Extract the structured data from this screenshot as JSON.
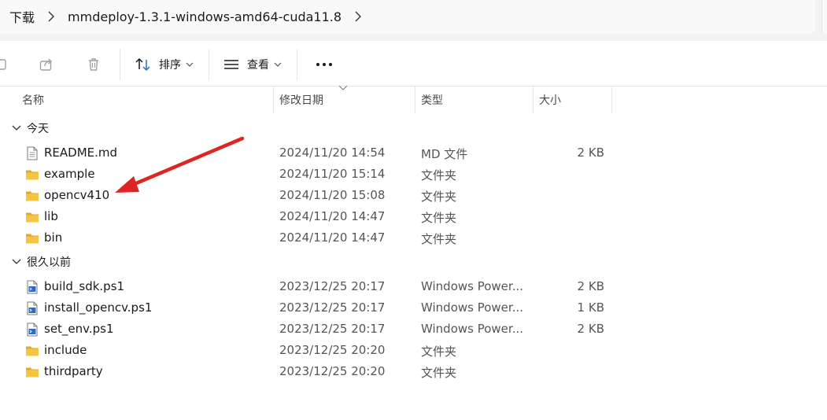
{
  "breadcrumb": [
    "下载",
    "mmdeploy-1.3.1-windows-amd64-cuda11.8"
  ],
  "toolbar": {
    "sort_label": "排序",
    "view_label": "查看"
  },
  "columns": {
    "name": "名称",
    "date": "修改日期",
    "type": "类型",
    "size": "大小"
  },
  "groups": [
    {
      "label": "今天",
      "items": [
        {
          "name": "README.md",
          "date": "2024/11/20 14:54",
          "type": "MD 文件",
          "size": "2 KB",
          "icon": "document-icon"
        },
        {
          "name": "example",
          "date": "2024/11/20 15:14",
          "type": "文件夹",
          "size": "",
          "icon": "folder-icon"
        },
        {
          "name": "opencv410",
          "date": "2024/11/20 15:08",
          "type": "文件夹",
          "size": "",
          "icon": "folder-icon"
        },
        {
          "name": "lib",
          "date": "2024/11/20 14:47",
          "type": "文件夹",
          "size": "",
          "icon": "folder-icon"
        },
        {
          "name": "bin",
          "date": "2024/11/20 14:47",
          "type": "文件夹",
          "size": "",
          "icon": "folder-icon"
        }
      ]
    },
    {
      "label": "很久以前",
      "items": [
        {
          "name": "build_sdk.ps1",
          "date": "2023/12/25 20:17",
          "type": "Windows Power...",
          "size": "2 KB",
          "icon": "powershell-script-icon"
        },
        {
          "name": "install_opencv.ps1",
          "date": "2023/12/25 20:17",
          "type": "Windows Power...",
          "size": "1 KB",
          "icon": "powershell-script-icon"
        },
        {
          "name": "set_env.ps1",
          "date": "2023/12/25 20:17",
          "type": "Windows Power...",
          "size": "2 KB",
          "icon": "powershell-script-icon"
        },
        {
          "name": "include",
          "date": "2023/12/25 20:20",
          "type": "文件夹",
          "size": "",
          "icon": "folder-icon"
        },
        {
          "name": "thirdparty",
          "date": "2023/12/25 20:20",
          "type": "文件夹",
          "size": "",
          "icon": "folder-icon"
        }
      ]
    }
  ],
  "colors": {
    "folder": "#f5c443",
    "folder_dark": "#e3a82b",
    "annotation_arrow": "#e02424"
  }
}
